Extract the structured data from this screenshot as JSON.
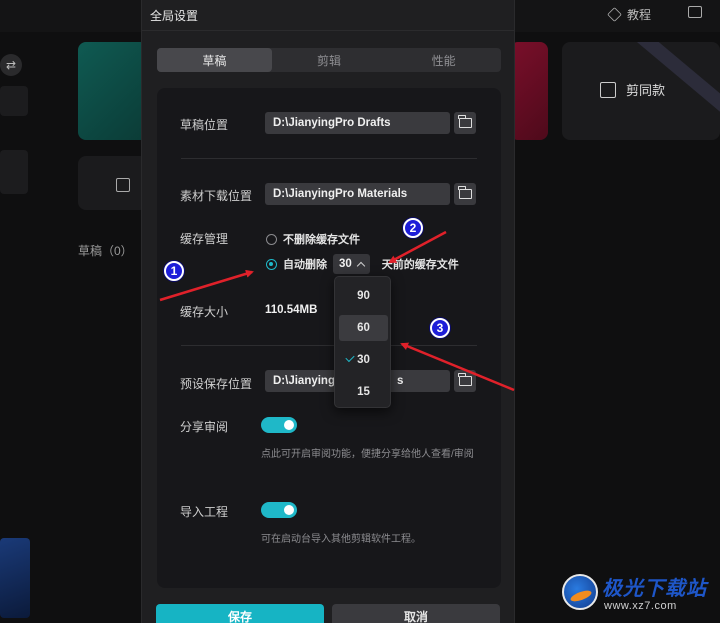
{
  "background": {
    "header": {
      "tutorial_label": "教程"
    },
    "jiantong_label": "剪同款",
    "drafts_label": "草稿（0）"
  },
  "dialog": {
    "title": "全局设置",
    "tabs": [
      {
        "label": "草稿",
        "active": true
      },
      {
        "label": "剪辑",
        "active": false
      },
      {
        "label": "性能",
        "active": false
      }
    ],
    "draft_location": {
      "label": "草稿位置",
      "value": "D:\\JianyingPro Drafts"
    },
    "material_location": {
      "label": "素材下载位置",
      "value": "D:\\JianyingPro Materials"
    },
    "cache": {
      "label": "缓存管理",
      "option_keep": "不删除缓存文件",
      "option_auto_prefix": "自动删除",
      "option_auto_suffix": "天前的缓存文件",
      "selected_days": "30",
      "dropdown_options": [
        "90",
        "60",
        "30",
        "15"
      ],
      "hovered_option": "60",
      "checked_option": "30"
    },
    "cache_size": {
      "label": "缓存大小",
      "value": "110.54MB"
    },
    "preset_save": {
      "label": "预设保存位置",
      "value_start": "D:\\Jianying",
      "value_end": "s"
    },
    "share_review": {
      "label": "分享审阅",
      "enabled": true,
      "hint": "点此可开启审阅功能，便捷分享给他人查看/审阅"
    },
    "import_project": {
      "label": "导入工程",
      "enabled": true,
      "hint": "可在启动台导入其他剪辑软件工程。"
    },
    "buttons": {
      "save": "保存",
      "cancel": "取消"
    }
  },
  "annotations": {
    "badges": [
      "1",
      "2",
      "3"
    ],
    "arrow_color": "#e0212a",
    "badge_color": "#1d1dd8"
  },
  "watermark": {
    "name": "极光下载站",
    "url": "www.xz7.com"
  },
  "colors": {
    "accent": "#1fb8c8",
    "panel": "#17171a",
    "dialog": "#1f1f21"
  }
}
